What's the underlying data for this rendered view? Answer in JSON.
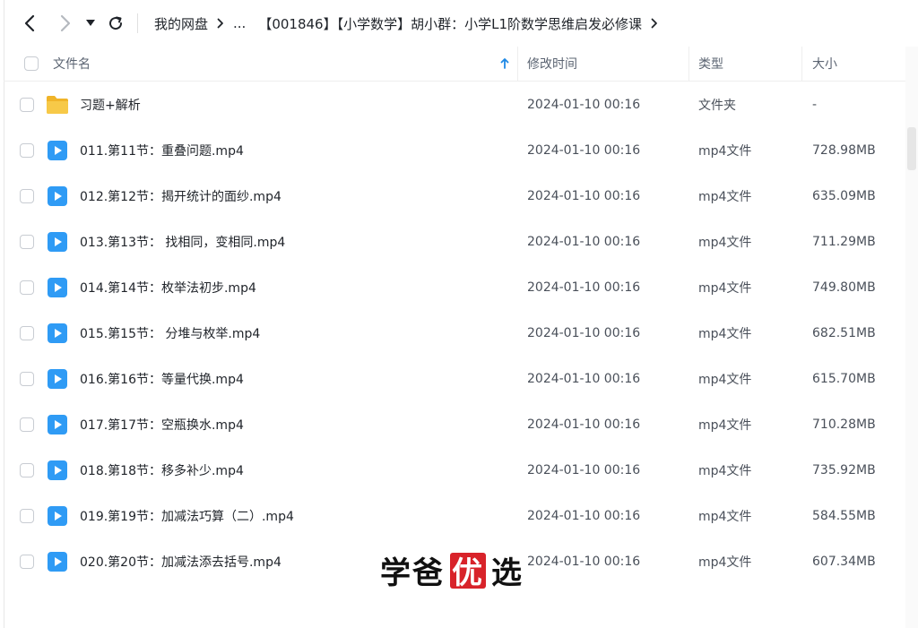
{
  "breadcrumb": {
    "items": [
      "我的网盘",
      "...",
      "【001846】【小学数学】胡小群：小学L1阶数学思维启发必修课"
    ]
  },
  "columns": {
    "name": "文件名",
    "modified": "修改时间",
    "type": "类型",
    "size": "大小"
  },
  "files": [
    {
      "name": "习题+解析",
      "modified": "2024-01-10 00:16",
      "type": "文件夹",
      "size": "-",
      "icon": "folder-icon"
    },
    {
      "name": "011.第11节：重叠问题.mp4",
      "modified": "2024-01-10 00:16",
      "type": "mp4文件",
      "size": "728.98MB",
      "icon": "video-file-icon"
    },
    {
      "name": "012.第12节：揭开统计的面纱.mp4",
      "modified": "2024-01-10 00:16",
      "type": "mp4文件",
      "size": "635.09MB",
      "icon": "video-file-icon"
    },
    {
      "name": "013.第13节： 找相同，变相同.mp4",
      "modified": "2024-01-10 00:16",
      "type": "mp4文件",
      "size": "711.29MB",
      "icon": "video-file-icon"
    },
    {
      "name": "014.第14节：枚举法初步.mp4",
      "modified": "2024-01-10 00:16",
      "type": "mp4文件",
      "size": "749.80MB",
      "icon": "video-file-icon"
    },
    {
      "name": "015.第15节： 分堆与枚举.mp4",
      "modified": "2024-01-10 00:16",
      "type": "mp4文件",
      "size": "682.51MB",
      "icon": "video-file-icon"
    },
    {
      "name": "016.第16节：等量代换.mp4",
      "modified": "2024-01-10 00:16",
      "type": "mp4文件",
      "size": "615.70MB",
      "icon": "video-file-icon"
    },
    {
      "name": "017.第17节：空瓶换水.mp4",
      "modified": "2024-01-10 00:16",
      "type": "mp4文件",
      "size": "710.28MB",
      "icon": "video-file-icon"
    },
    {
      "name": "018.第18节：移多补少.mp4",
      "modified": "2024-01-10 00:16",
      "type": "mp4文件",
      "size": "735.92MB",
      "icon": "video-file-icon"
    },
    {
      "name": "019.第19节：加减法巧算（二）.mp4",
      "modified": "2024-01-10 00:16",
      "type": "mp4文件",
      "size": "584.55MB",
      "icon": "video-file-icon"
    },
    {
      "name": "020.第20节：加减法添去括号.mp4",
      "modified": "2024-01-10 00:16",
      "type": "mp4文件",
      "size": "607.34MB",
      "icon": "video-file-icon"
    }
  ],
  "watermark": {
    "chars": [
      "学",
      "爸",
      "优",
      "选"
    ]
  },
  "colors": {
    "accent": "#1e88e5",
    "folder": "#f7c948",
    "video": "#2f9bf5",
    "watermark_red": "#d8232a"
  }
}
